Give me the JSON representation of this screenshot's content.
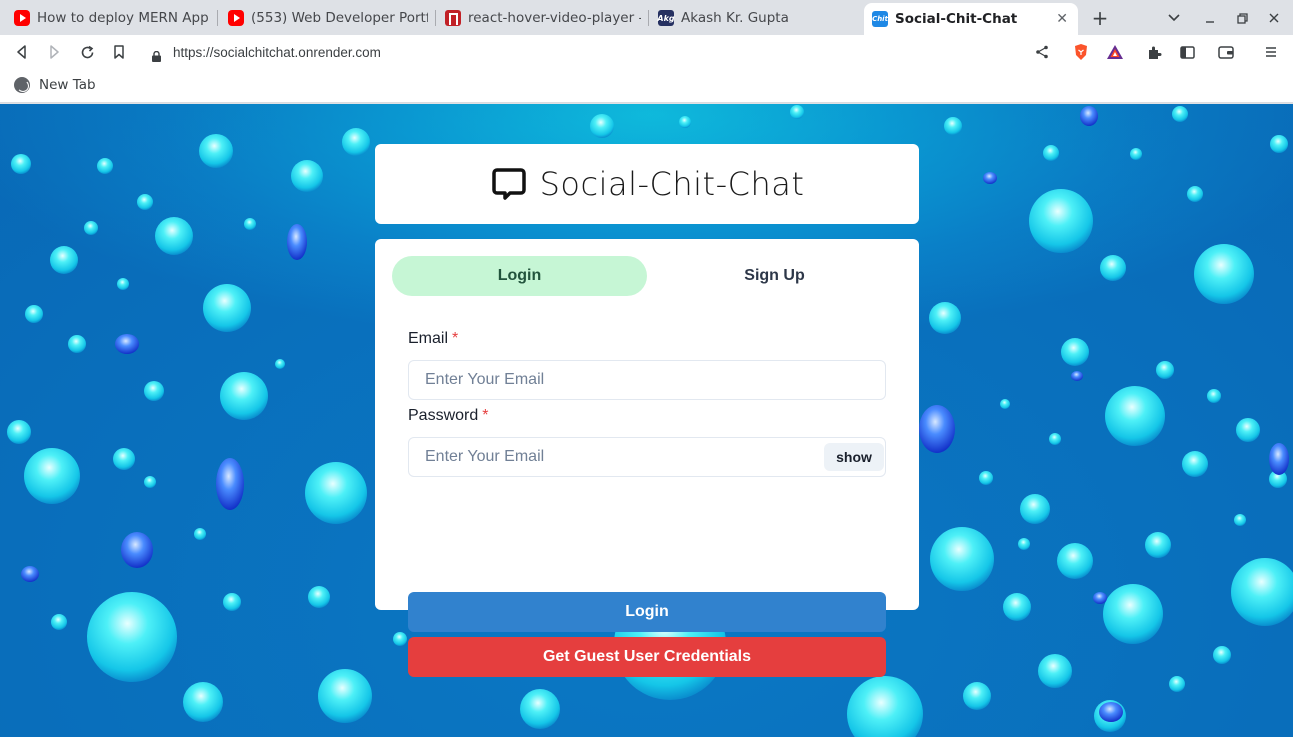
{
  "browser": {
    "tabs": [
      {
        "title": "How to deploy MERN App",
        "favicon": "youtube-icon"
      },
      {
        "title": "(553) Web Developer Portf",
        "favicon": "youtube-icon"
      },
      {
        "title": "react-hover-video-player -",
        "favicon": "npm-icon"
      },
      {
        "title": "Akash Kr. Gupta",
        "favicon": "akg-icon",
        "favicon_text": "Akg"
      },
      {
        "title": "Social-Chit-Chat",
        "favicon": "chit-icon",
        "favicon_text": "Chit",
        "active": true
      }
    ],
    "url": "https://socialchitchat.onrender.com",
    "bookmarks": [
      {
        "label": "New Tab",
        "icon": "globe-icon"
      }
    ],
    "colors": {
      "tabstrip": "#dee1e6",
      "toolbar": "#ffffff"
    }
  },
  "app": {
    "title": "Social-Chit-Chat",
    "logo_icon": "chat-bubble-icon",
    "tabs": [
      {
        "label": "Login",
        "selected": true
      },
      {
        "label": "Sign Up",
        "selected": false
      }
    ],
    "email": {
      "label": "Email",
      "required_mark": "*",
      "placeholder": "Enter Your Email"
    },
    "password": {
      "label": "Password",
      "required_mark": "*",
      "placeholder": "Enter Your Email",
      "toggle_label": "show"
    },
    "login_button": "Login",
    "guest_button": "Get Guest User Credentials",
    "colors": {
      "selected_tab_bg": "#c6f6d5",
      "selected_tab_text": "#22543d",
      "login_button": "#3182ce",
      "guest_button": "#e53e3e",
      "required": "#e53e3e"
    }
  }
}
